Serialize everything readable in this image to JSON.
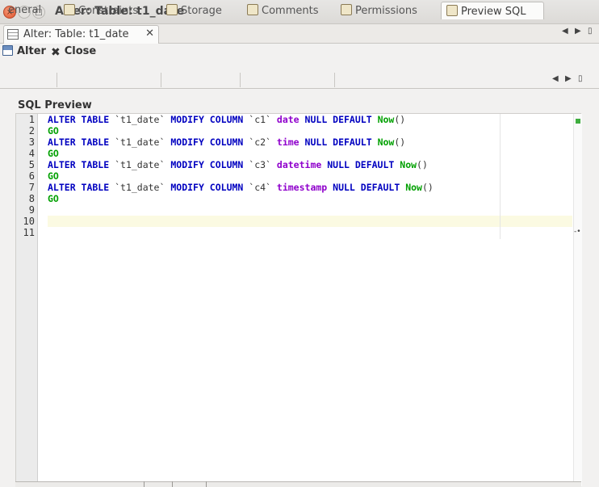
{
  "window": {
    "title": "Alter: Table: t1_date",
    "controls": {
      "close": "×",
      "minimize": "–",
      "maximize": "□"
    }
  },
  "editor_tab": {
    "label": "Alter: Table: t1_date",
    "close": "✕"
  },
  "tab_nav": {
    "prev": "◀",
    "next": "▶",
    "menu": "▯"
  },
  "toolbar": {
    "alter_label": "Alter",
    "close_label": "Close"
  },
  "property_tabs": {
    "items": [
      {
        "label": "eneral",
        "icon": "general-icon"
      },
      {
        "label": "Constraints",
        "icon": "constraints-icon"
      },
      {
        "label": "Storage",
        "icon": "storage-icon"
      },
      {
        "label": "Comments",
        "icon": "comments-icon"
      },
      {
        "label": "Permissions",
        "icon": "permissions-icon"
      },
      {
        "label": "Preview SQL",
        "icon": "preview-sql-icon",
        "active": true
      }
    ],
    "nav": {
      "prev": "◀",
      "next": "▶",
      "menu": "▯"
    }
  },
  "sql_preview": {
    "section_label": "SQL Preview",
    "line_numbers": [
      "1",
      "2",
      "3",
      "4",
      "5",
      "6",
      "7",
      "8",
      "9",
      "10",
      "11"
    ],
    "current_line": 10,
    "lines": [
      [
        {
          "t": "ALTER TABLE",
          "c": "kw"
        },
        {
          "t": " `t1_date` ",
          "c": "pl"
        },
        {
          "t": "MODIFY COLUMN",
          "c": "kw"
        },
        {
          "t": " `c1` ",
          "c": "pl"
        },
        {
          "t": "date",
          "c": "ty"
        },
        {
          "t": " ",
          "c": "pl"
        },
        {
          "t": "NULL DEFAULT",
          "c": "kw"
        },
        {
          "t": " ",
          "c": "pl"
        },
        {
          "t": "Now",
          "c": "fn"
        },
        {
          "t": "()",
          "c": "pl"
        }
      ],
      [
        {
          "t": "GO",
          "c": "go"
        }
      ],
      [
        {
          "t": "ALTER TABLE",
          "c": "kw"
        },
        {
          "t": " `t1_date` ",
          "c": "pl"
        },
        {
          "t": "MODIFY COLUMN",
          "c": "kw"
        },
        {
          "t": " `c2` ",
          "c": "pl"
        },
        {
          "t": "time",
          "c": "ty"
        },
        {
          "t": " ",
          "c": "pl"
        },
        {
          "t": "NULL DEFAULT",
          "c": "kw"
        },
        {
          "t": " ",
          "c": "pl"
        },
        {
          "t": "Now",
          "c": "fn"
        },
        {
          "t": "()",
          "c": "pl"
        }
      ],
      [
        {
          "t": "GO",
          "c": "go"
        }
      ],
      [
        {
          "t": "ALTER TABLE",
          "c": "kw"
        },
        {
          "t": " `t1_date` ",
          "c": "pl"
        },
        {
          "t": "MODIFY COLUMN",
          "c": "kw"
        },
        {
          "t": " `c3` ",
          "c": "pl"
        },
        {
          "t": "datetime",
          "c": "ty"
        },
        {
          "t": " ",
          "c": "pl"
        },
        {
          "t": "NULL DEFAULT",
          "c": "kw"
        },
        {
          "t": " ",
          "c": "pl"
        },
        {
          "t": "Now",
          "c": "fn"
        },
        {
          "t": "()",
          "c": "pl"
        }
      ],
      [
        {
          "t": "GO",
          "c": "go"
        }
      ],
      [
        {
          "t": "ALTER TABLE",
          "c": "kw"
        },
        {
          "t": " `t1_date` ",
          "c": "pl"
        },
        {
          "t": "MODIFY COLUMN",
          "c": "kw"
        },
        {
          "t": " `c4` ",
          "c": "pl"
        },
        {
          "t": "timestamp",
          "c": "ty"
        },
        {
          "t": " ",
          "c": "pl"
        },
        {
          "t": "NULL DEFAULT",
          "c": "kw"
        },
        {
          "t": " ",
          "c": "pl"
        },
        {
          "t": "Now",
          "c": "fn"
        },
        {
          "t": "()",
          "c": "pl"
        }
      ],
      [
        {
          "t": "GO",
          "c": "go"
        }
      ],
      [],
      [],
      []
    ],
    "overview_caret": "-•"
  },
  "colors": {
    "keyword": "#0000c0",
    "type": "#8f00cc",
    "function": "#00a000",
    "current_line_bg": "#fbfae2"
  }
}
